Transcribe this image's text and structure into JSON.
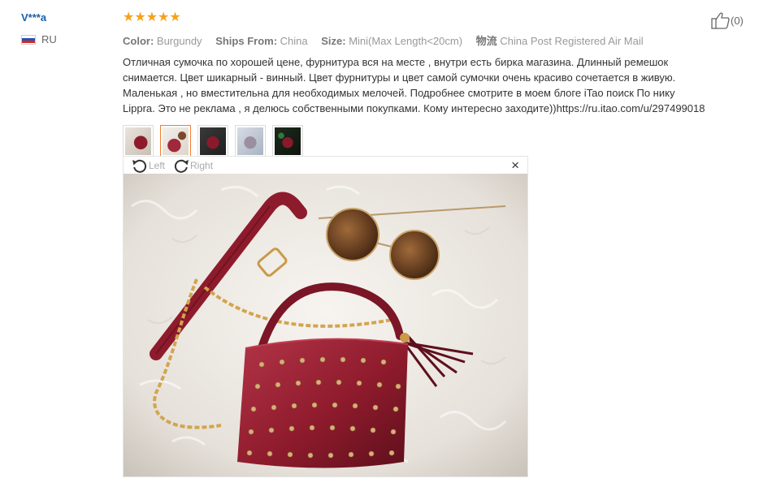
{
  "user": {
    "name": "V***a",
    "country": "RU"
  },
  "review": {
    "stars": "★★★★★",
    "meta": [
      {
        "key": "Color:",
        "value": "Burgundy"
      },
      {
        "key": "Ships From:",
        "value": "China"
      },
      {
        "key": "Size:",
        "value": "Mini(Max Length<20cm)"
      },
      {
        "key": "物流",
        "value": "China Post Registered Air Mail"
      }
    ],
    "text": "Отличная сумочка по хорошей цене, фурнитура вся на месте , внутри есть бирка магазина. Длинный ремешок снимается. Цвет шикарный - винный. Цвет фурнитуры и цвет самой сумочки очень красиво сочетается в живую. Маленькая , но вместительна для необходимых мелочей. Подробнее смотрите в моем блоге iTao поиск По нику Lippra. Это не реклама , я делюсь собственными покупками. Кому интересно заходите))https://ru.itao.com/u/297499018"
  },
  "viewer": {
    "left_label": "Left",
    "right_label": "Right",
    "close": "×"
  },
  "like": {
    "count": "(0)"
  },
  "colors": {
    "accent": "#f37b2f",
    "star": "#f7a01e",
    "link": "#1c5fa8",
    "bag": "#8e1b2c"
  }
}
